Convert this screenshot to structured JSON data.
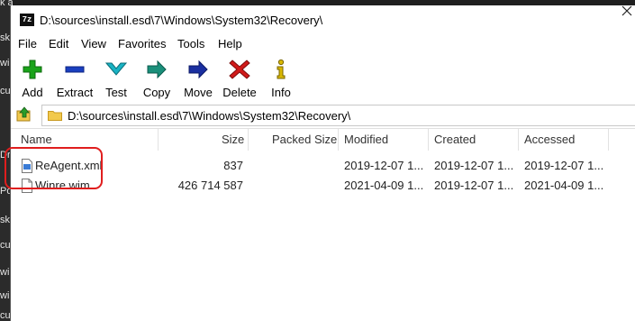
{
  "background": {
    "fragments": [
      "k access",
      "sk",
      "wi",
      "cu",
      "Dr",
      "Po",
      "sk",
      "cu",
      "wi",
      "wi",
      "cu"
    ]
  },
  "window": {
    "app_icon_text": "7z",
    "title": "D:\\sources\\install.esd\\7\\Windows\\System32\\Recovery\\"
  },
  "menu": {
    "items": [
      "File",
      "Edit",
      "View",
      "Favorites",
      "Tools",
      "Help"
    ]
  },
  "toolbar": {
    "buttons": [
      {
        "label": "Add",
        "icon": "plus-icon",
        "color": "#1aa31a"
      },
      {
        "label": "Extract",
        "icon": "minus-icon",
        "color": "#1a3fbf"
      },
      {
        "label": "Test",
        "icon": "check-icon",
        "color": "#19b3c4"
      },
      {
        "label": "Copy",
        "icon": "copy-arrow-icon",
        "color": "#1a8f7a"
      },
      {
        "label": "Move",
        "icon": "move-arrow-icon",
        "color": "#1a2fa0"
      },
      {
        "label": "Delete",
        "icon": "delete-x-icon",
        "color": "#d11a1a"
      },
      {
        "label": "Info",
        "icon": "info-icon",
        "color": "#d9b800"
      }
    ]
  },
  "address_bar": {
    "path": "D:\\sources\\install.esd\\7\\Windows\\System32\\Recovery\\"
  },
  "file_list": {
    "columns": [
      "Name",
      "Size",
      "Packed Size",
      "Modified",
      "Created",
      "Accessed"
    ],
    "rows": [
      {
        "name": "ReAgent.xml",
        "size": "837",
        "packed": "",
        "modified": "2019-12-07 1...",
        "created": "2019-12-07 1...",
        "accessed": "2019-12-07 1..."
      },
      {
        "name": "Winre.wim",
        "size": "426 714 587",
        "packed": "",
        "modified": "2021-04-09 1...",
        "created": "2019-12-07 1...",
        "accessed": "2021-04-09 1..."
      }
    ]
  },
  "colors": {
    "highlight": "#e01e1e",
    "folder": "#f2c94c"
  }
}
